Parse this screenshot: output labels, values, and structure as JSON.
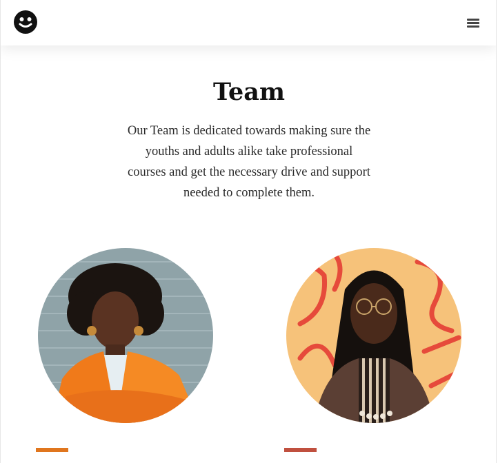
{
  "header": {
    "logo_icon": "smiley-logo-icon",
    "menu_icon": "hamburger-menu-icon"
  },
  "team": {
    "title": "Team",
    "intro": "Our Team is dedicated towards making sure the youths and adults alike take professional courses and get the necessary drive and support needed to complete them."
  },
  "members": [
    {
      "photo": "team-member-photo",
      "accent_color": "#e0761e"
    },
    {
      "photo": "team-member-photo",
      "accent_color": "#c0503f"
    }
  ],
  "colors": {
    "accent_orange": "#e0761e",
    "accent_red": "#c0503f"
  }
}
